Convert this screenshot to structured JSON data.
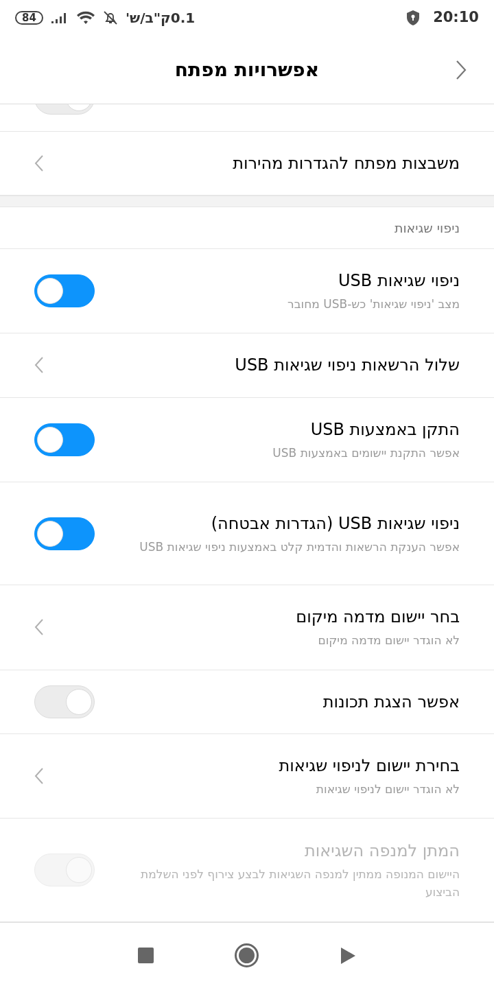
{
  "status_bar": {
    "battery": "84",
    "data_rate": "0.1ק\"ב/ש'",
    "time": "20:10"
  },
  "header": {
    "title": "אפשרויות מפתח"
  },
  "items": [
    {
      "kind": "partial_toggle",
      "on": false
    },
    {
      "kind": "link",
      "title": "משבצות מפתח להגדרות מהירות"
    },
    {
      "kind": "gap"
    },
    {
      "kind": "section",
      "title": "ניפוי שגיאות"
    },
    {
      "kind": "toggle",
      "title": "ניפוי שגיאות USB",
      "subtitle": "מצב 'ניפוי שגיאות' כש-USB מחובר",
      "on": true,
      "disabled": false
    },
    {
      "kind": "link",
      "title": "שלול הרשאות ניפוי שגיאות USB"
    },
    {
      "kind": "toggle",
      "title": "התקן באמצעות USB",
      "subtitle": "אפשר התקנת יישומים באמצעות USB",
      "on": true,
      "disabled": false
    },
    {
      "kind": "toggle",
      "title": "ניפוי שגיאות USB (הגדרות אבטחה)",
      "subtitle": "אפשר הענקת הרשאות והדמית קלט באמצעות ניפוי שגיאות USB",
      "on": true,
      "disabled": false
    },
    {
      "kind": "link",
      "title": "בחר יישום מדמה מיקום",
      "subtitle": "לא הוגדר יישום מדמה מיקום"
    },
    {
      "kind": "toggle",
      "title": "אפשר הצגת תכונות",
      "on": false,
      "disabled": false
    },
    {
      "kind": "link",
      "title": "בחירת יישום לניפוי שגיאות",
      "subtitle": "לא הוגדר יישום לניפוי שגיאות"
    },
    {
      "kind": "toggle",
      "title": "המתן למנפה השגיאות",
      "subtitle": "היישום המנופה ממתין למנפה השגיאות לבצע צירוף לפני השלמת הביצוע",
      "on": false,
      "disabled": true
    }
  ]
}
